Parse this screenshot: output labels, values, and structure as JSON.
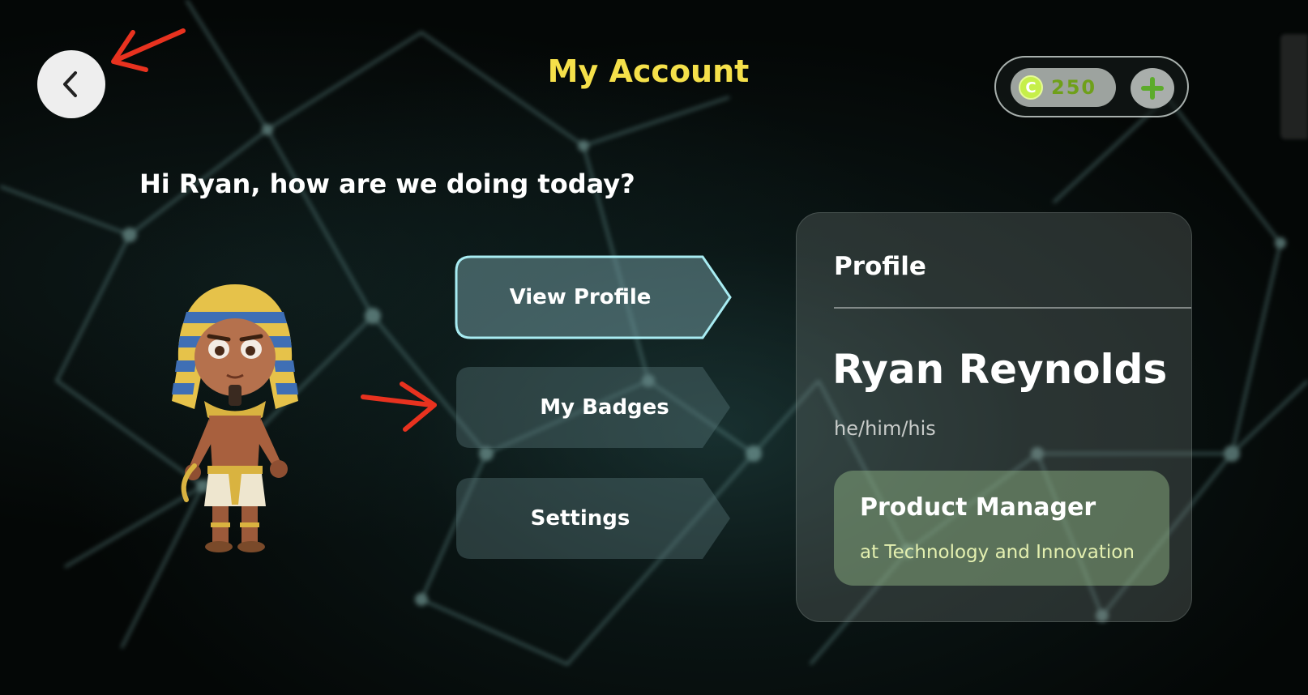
{
  "header": {
    "title": "My Account",
    "back_icon": "chevron-left-icon"
  },
  "wallet": {
    "coin_symbol": "C",
    "coin_count": "250",
    "add_icon": "plus-icon",
    "accent_color": "#6fa01a"
  },
  "greeting": "Hi Ryan, how are we doing today?",
  "menu": {
    "items": [
      {
        "label": "View Profile",
        "active": true
      },
      {
        "label": "My Badges",
        "active": false
      },
      {
        "label": "Settings",
        "active": false
      }
    ]
  },
  "profile": {
    "heading": "Profile",
    "name": "Ryan Reynolds",
    "pronouns": "he/him/his",
    "role_title": "Product Manager",
    "role_org": "at Technology and Innovation"
  },
  "colors": {
    "title": "#f5e04a",
    "active_outline": "#a8ecf2",
    "annotation_arrow": "#e8321f"
  }
}
